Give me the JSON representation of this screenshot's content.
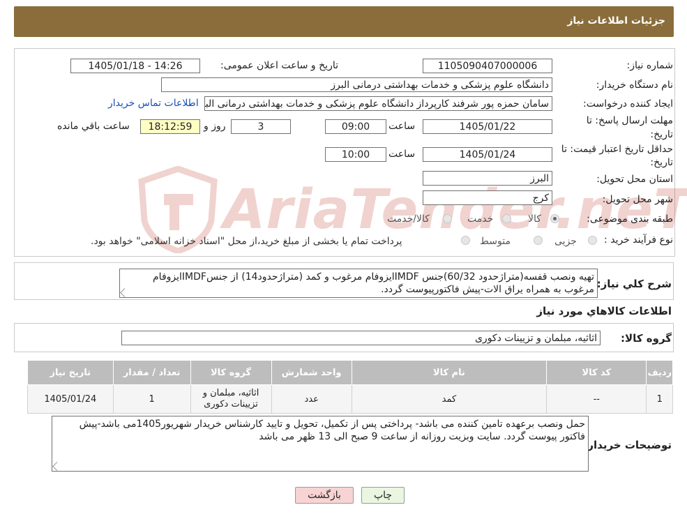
{
  "header": {
    "title": "جزئیات اطلاعات نیاز"
  },
  "form": {
    "need_number_label": "شماره نیاز:",
    "need_number": "1105090407000006",
    "announce_label": "تاریخ و ساعت اعلان عمومی:",
    "announce_value": "1405/01/18 - 14:26",
    "buyer_org_label": "نام دستگاه خریدار:",
    "buyer_org": "دانشگاه علوم پزشکی و خدمات بهداشتی  درمانی البرز",
    "creator_label": "ایجاد کننده درخواست:",
    "creator": "سامان حمزه پور شرفند کارپرداز دانشگاه علوم پزشکی و خدمات بهداشتی  درمانی البرز",
    "contact_link": "اطلاعات تماس خریدار",
    "deadline_label_1": "مهلت ارسال پاسخ: تا",
    "deadline_label_2": "تاریخ:",
    "deadline_date": "1405/01/22",
    "time_label": "ساعت",
    "deadline_time": "09:00",
    "days": "3",
    "days_label": "روز و",
    "remaining_time": "18:12:59",
    "remaining_label": "ساعت باقي مانده",
    "validity_label_1": "حداقل تاریخ اعتبار قیمت: تا",
    "validity_label_2": "تاریخ:",
    "validity_date": "1405/01/24",
    "validity_time_label": "ساعت",
    "validity_time": "10:00",
    "province_label": "استان محل تحویل:",
    "province": "البرز",
    "city_label": "شهر محل تحویل:",
    "city": "کرج",
    "category_label": "طبقه بندی موضوعی:",
    "category_options": [
      "کالا",
      "خدمت",
      "کالا/خدمت"
    ],
    "category_selected": "کالا",
    "process_label": "نوع فرآیند خرید :",
    "process_options": [
      "جزیی",
      "متوسط"
    ],
    "process_note": "پرداخت تمام یا بخشی از مبلغ خرید،از محل \"اسناد خزانه اسلامی\" خواهد بود."
  },
  "watermark": {
    "text": "AriaTender.neT"
  },
  "description": {
    "label": "شرح کلي نياز:",
    "text": "تهیه ونصب قفسه(متراژحدود 60/32)جنس IMDFایزوفام مرغوب و کمد (متراژحدود14) از جنسIMDFایزوفام مرغوب به همراه یراق الات-پیش فاکتورپیوست گردد."
  },
  "goods_info": {
    "title": "اطلاعات کالاهاي مورد نياز",
    "group_label": "گروه کالا:",
    "group_value": "اثاثیه، مبلمان و تزیینات دکوری"
  },
  "table": {
    "headers": [
      "رديف",
      "کد کالا",
      "نام کالا",
      "واحد شمارش",
      "گروه کالا",
      "تعداد / مقدار",
      "تاریخ نیاز"
    ],
    "rows": [
      [
        "1",
        "--",
        "کمد",
        "عدد",
        "اثاثیه، مبلمان و تزیینات دکوری",
        "1",
        "1405/01/24"
      ]
    ]
  },
  "buyer_notes": {
    "label": "توضیحات خریدار:",
    "text": "حمل ونصب برعهده تامین کننده می باشد- پرداختی پس از تکمیل، تحویل و تایید کارشناس خریدار شهریور1405می باشد-پیش فاکتور پیوست گردد. سایت وبزیت روزانه از ساعت 9 صبح الی 13 ظهر می باشد"
  },
  "buttons": {
    "print": "چاپ",
    "back": "بازگشت"
  },
  "colors": {
    "header_bg": "#8b6d3b",
    "table_header": "#bdbdbd",
    "back_button_bg": "#f8d3d3",
    "print_button_bg": "#eaf6e0"
  }
}
